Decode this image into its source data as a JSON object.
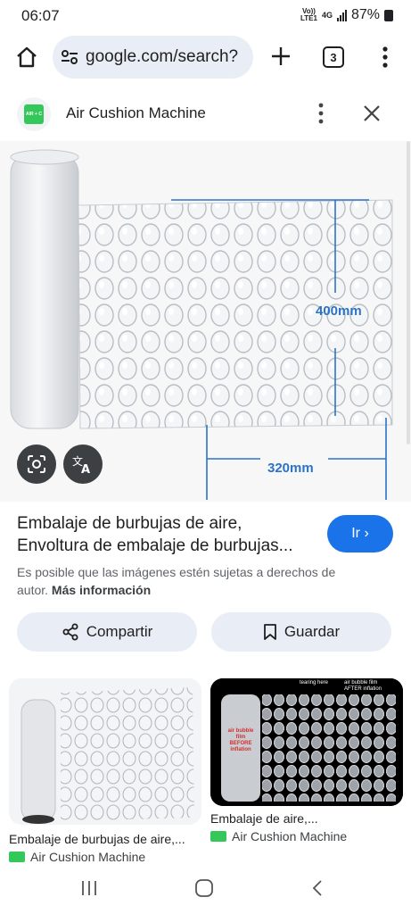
{
  "status": {
    "time": "06:07",
    "volte_top": "Vo))",
    "volte_bottom": "LTE1",
    "network": "4G",
    "battery": "87%"
  },
  "browser": {
    "url": "google.com/search?",
    "tab_count": "3"
  },
  "viewer": {
    "source_name": "Air Cushion Machine",
    "favicon_text": "AIR + C",
    "dimension_height": "400mm",
    "dimension_width": "320mm",
    "title": "Embalaje de burbujas de aire, Envoltura de embalaje de burbujas...",
    "go_button": "Ir ›",
    "copyright_text": "Es posible que las imágenes estén sujetas a derechos de autor.",
    "more_info": "Más información",
    "share_label": "Compartir",
    "save_label": "Guardar"
  },
  "related": [
    {
      "title": "Embalaje de burbujas de aire,...",
      "source": "Air Cushion Machine"
    },
    {
      "title": "Embalaje de aire,...",
      "source": "Air Cushion Machine",
      "image_labels": {
        "tearing": "tearing here",
        "after": "air bubble film AFTER inflation",
        "before": "air bubble film BEFORE inflation"
      }
    }
  ],
  "colors": {
    "accent": "#1a73e8",
    "chip_bg": "#e9eef6",
    "favicon": "#34c759",
    "dimension_blue": "#2b73c7"
  }
}
